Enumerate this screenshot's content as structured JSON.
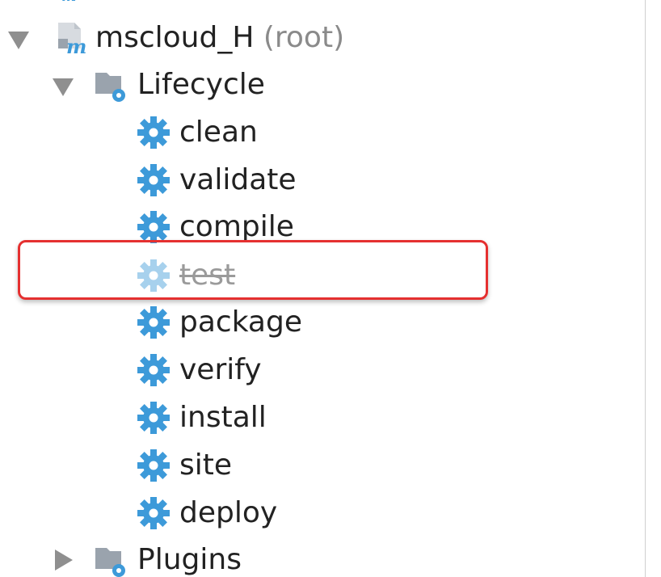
{
  "tree": {
    "project": {
      "name": "mscloud_H",
      "suffix": "(root)"
    },
    "lifecycle": {
      "label": "Lifecycle",
      "goals": [
        {
          "label": "clean",
          "disabled": false
        },
        {
          "label": "validate",
          "disabled": false
        },
        {
          "label": "compile",
          "disabled": false
        },
        {
          "label": "test",
          "disabled": true
        },
        {
          "label": "package",
          "disabled": false
        },
        {
          "label": "verify",
          "disabled": false
        },
        {
          "label": "install",
          "disabled": false
        },
        {
          "label": "site",
          "disabled": false
        },
        {
          "label": "deploy",
          "disabled": false
        }
      ]
    },
    "plugins": {
      "label": "Plugins"
    }
  },
  "colors": {
    "gear_icon": "#3d9ad9",
    "folder_icon": "#9aa3ad",
    "highlight_border": "#e53030",
    "expand_arrow": "#8f8f8f"
  }
}
